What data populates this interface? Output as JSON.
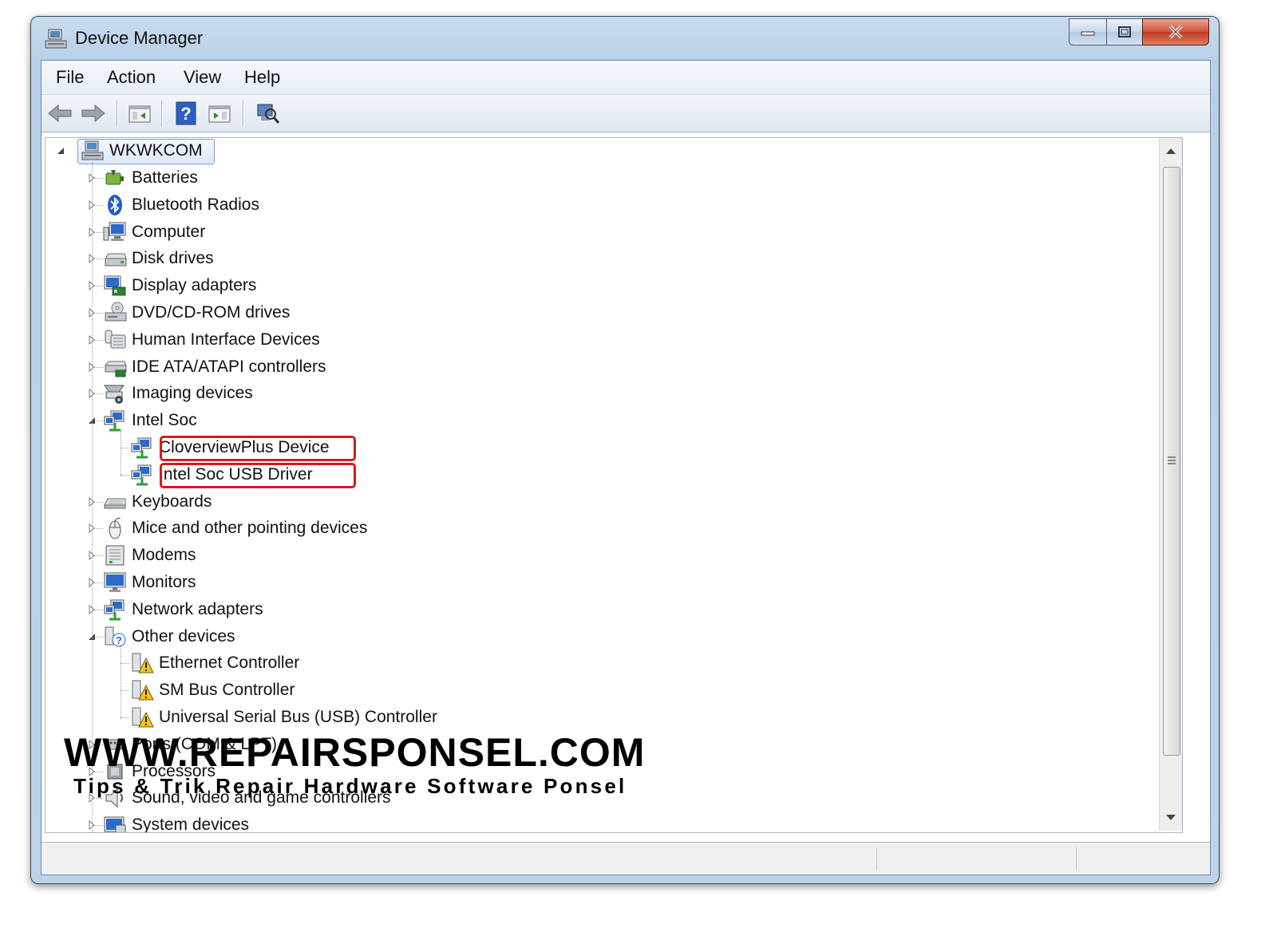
{
  "window": {
    "title": "Device Manager"
  },
  "menubar": {
    "items": [
      "File",
      "Action",
      "View",
      "Help"
    ]
  },
  "toolbar": {
    "buttons": [
      "back-icon",
      "forward-icon",
      "show-hide-console-tree-icon",
      "help-icon",
      "properties-icon",
      "scan-hardware-icon"
    ]
  },
  "tree": {
    "root": "WKWKCOM",
    "rows": [
      {
        "label": "Batteries",
        "level": 1,
        "expander": "collapsed",
        "icon": "battery-icon"
      },
      {
        "label": "Bluetooth Radios",
        "level": 1,
        "expander": "collapsed",
        "icon": "bluetooth-icon"
      },
      {
        "label": "Computer",
        "level": 1,
        "expander": "collapsed",
        "icon": "computer-icon"
      },
      {
        "label": "Disk drives",
        "level": 1,
        "expander": "collapsed",
        "icon": "disk-drive-icon"
      },
      {
        "label": "Display adapters",
        "level": 1,
        "expander": "collapsed",
        "icon": "display-adapter-icon"
      },
      {
        "label": "DVD/CD-ROM drives",
        "level": 1,
        "expander": "collapsed",
        "icon": "dvd-drive-icon"
      },
      {
        "label": "Human Interface Devices",
        "level": 1,
        "expander": "collapsed",
        "icon": "hid-icon"
      },
      {
        "label": "IDE ATA/ATAPI controllers",
        "level": 1,
        "expander": "collapsed",
        "icon": "ide-controller-icon"
      },
      {
        "label": "Imaging devices",
        "level": 1,
        "expander": "collapsed",
        "icon": "imaging-device-icon"
      },
      {
        "label": "Intel Soc",
        "level": 1,
        "expander": "expanded",
        "icon": "network-device-icon"
      },
      {
        "label": "CloverviewPlus Device",
        "level": 2,
        "expander": "none",
        "icon": "network-device-icon",
        "highlight": true
      },
      {
        "label": "Intel Soc USB Driver",
        "level": 2,
        "expander": "none",
        "icon": "network-device-icon",
        "highlight": true
      },
      {
        "label": "Keyboards",
        "level": 1,
        "expander": "collapsed",
        "icon": "keyboard-icon"
      },
      {
        "label": "Mice and other pointing devices",
        "level": 1,
        "expander": "collapsed",
        "icon": "mouse-icon"
      },
      {
        "label": "Modems",
        "level": 1,
        "expander": "collapsed",
        "icon": "modem-icon"
      },
      {
        "label": "Monitors",
        "level": 1,
        "expander": "collapsed",
        "icon": "monitor-icon"
      },
      {
        "label": "Network adapters",
        "level": 1,
        "expander": "collapsed",
        "icon": "network-device-icon"
      },
      {
        "label": "Other devices",
        "level": 1,
        "expander": "expanded",
        "icon": "unknown-device-icon"
      },
      {
        "label": "Ethernet Controller",
        "level": 2,
        "expander": "none",
        "icon": "warning-device-icon"
      },
      {
        "label": "SM Bus Controller",
        "level": 2,
        "expander": "none",
        "icon": "warning-device-icon"
      },
      {
        "label": "Universal Serial Bus (USB) Controller",
        "level": 2,
        "expander": "none",
        "icon": "warning-device-icon"
      },
      {
        "label": "Ports (COM & LPT)",
        "level": 1,
        "expander": "collapsed",
        "icon": "port-icon"
      },
      {
        "label": "Processors",
        "level": 1,
        "expander": "collapsed",
        "icon": "processor-icon"
      },
      {
        "label": "Sound, video and game controllers",
        "level": 1,
        "expander": "collapsed",
        "icon": "speaker-icon"
      },
      {
        "label": "System devices",
        "level": 1,
        "expander": "collapsed",
        "icon": "system-device-icon"
      }
    ]
  },
  "watermark": {
    "title": "WWW.REPAIRSPONSEL.COM",
    "subtitle": "Tips & Trik Repair Hardware Software Ponsel"
  },
  "colors": {
    "highlight": "#d51b1b",
    "selection": "#dce9f8"
  }
}
